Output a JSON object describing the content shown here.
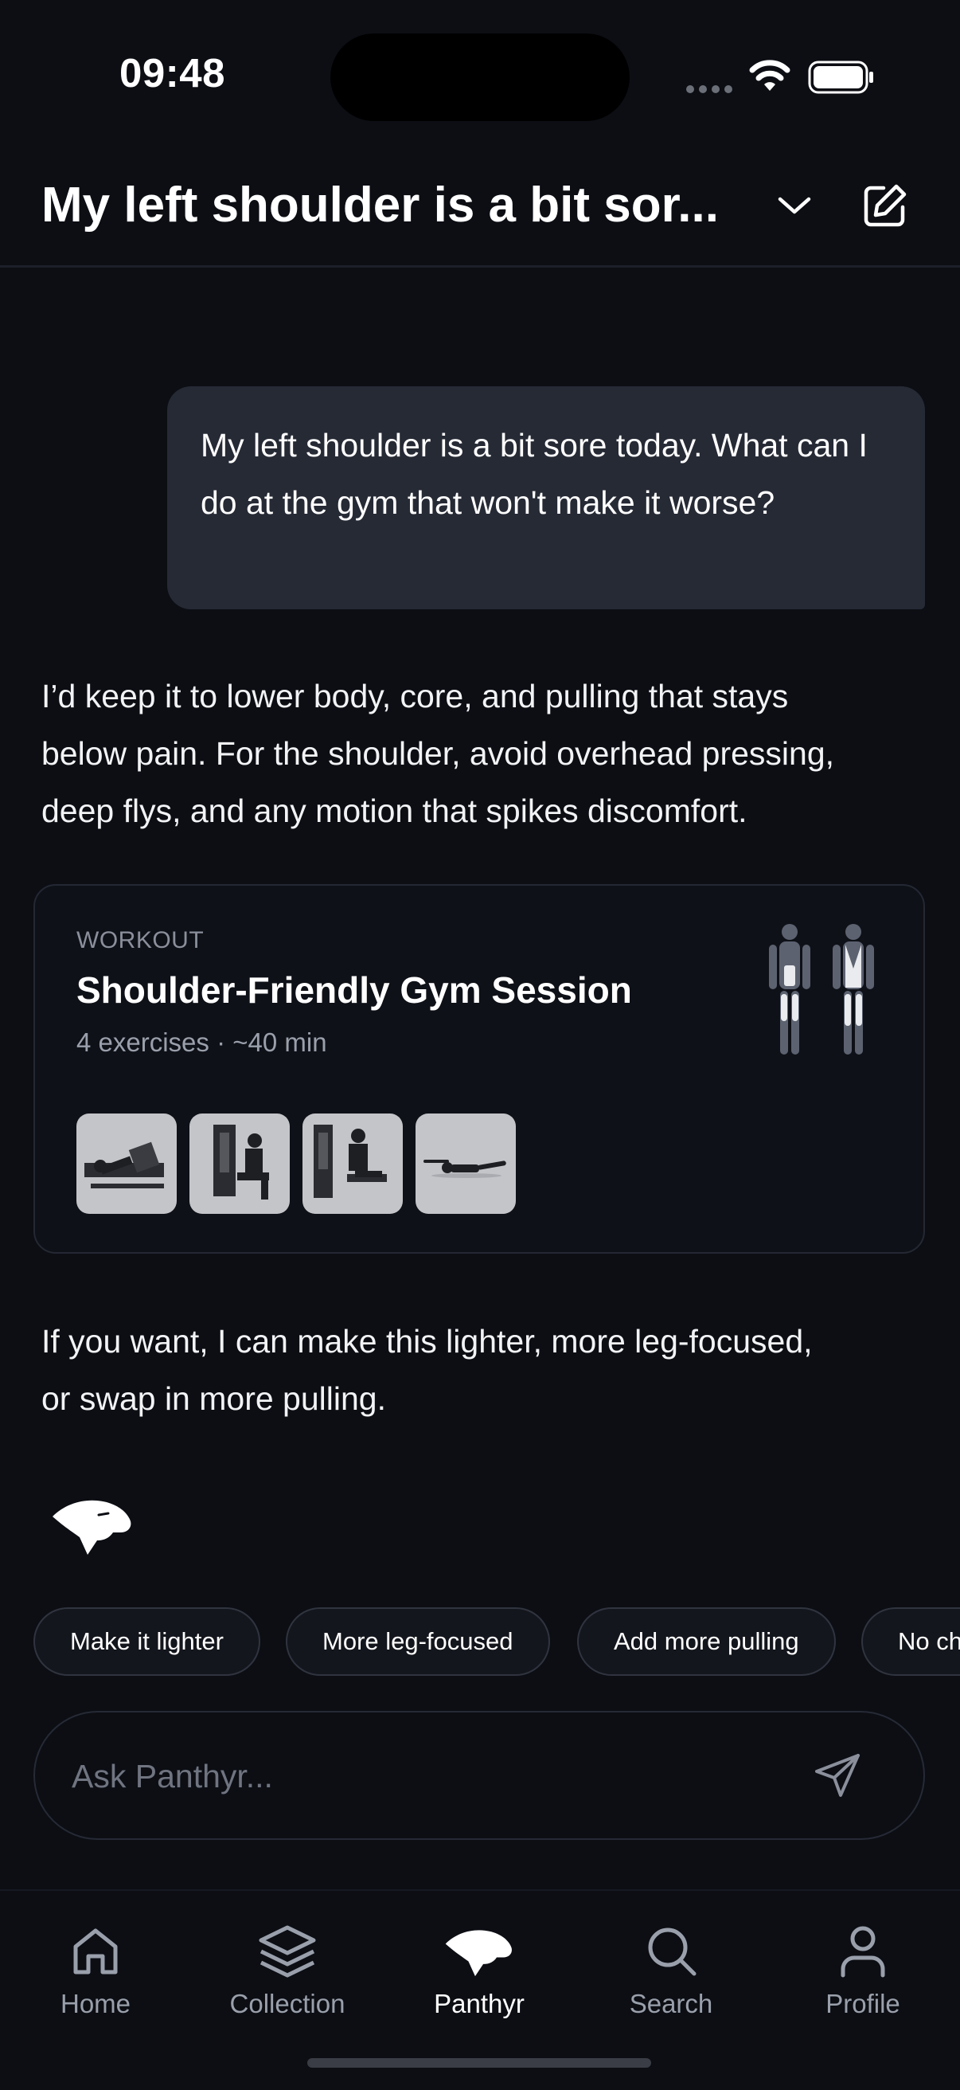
{
  "status_bar": {
    "time": "09:48"
  },
  "header": {
    "title": "My left shoulder is a bit sor..."
  },
  "user_message": "My left shoulder is a bit sore today. What can I do at the gym that won't make it worse?",
  "assistant": {
    "intro_line1": "I’d keep it to lower body, core, and pulling that stays",
    "intro_line2": "below pain. For the shoulder, avoid overhead pressing,",
    "intro_line3": "deep flys, and any motion that spikes discomfort.",
    "followup_line1": "If you want, I can make this lighter, more leg-focused,",
    "followup_line2": "or swap in more pulling."
  },
  "workout_card": {
    "label": "WORKOUT",
    "title": "Shoulder-Friendly Gym Session",
    "meta": "4 exercises · ~40 min",
    "thumbnails": [
      "leg-press",
      "seated-machine",
      "cable-row",
      "floor-stretch"
    ]
  },
  "chips": [
    "Make it lighter",
    "More leg-focused",
    "Add more pulling",
    "No ch"
  ],
  "input": {
    "placeholder": "Ask Panthyr..."
  },
  "tabs": [
    {
      "label": "Home",
      "icon": "home-icon"
    },
    {
      "label": "Collection",
      "icon": "layers-icon"
    },
    {
      "label": "Panthyr",
      "icon": "panther-icon",
      "active": true
    },
    {
      "label": "Search",
      "icon": "search-icon"
    },
    {
      "label": "Profile",
      "icon": "profile-icon"
    }
  ],
  "colors": {
    "background": "#0c0e14",
    "bubble": "#262a35",
    "muted": "#9aa0ab"
  }
}
